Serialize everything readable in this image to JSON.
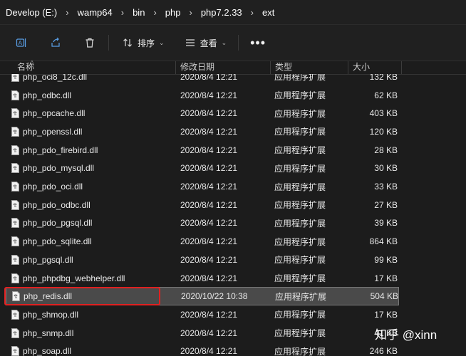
{
  "breadcrumb": [
    "Develop (E:)",
    "wamp64",
    "bin",
    "php",
    "php7.2.33",
    "ext"
  ],
  "toolbar": {
    "sort_label": "排序",
    "view_label": "查看",
    "more_label": "•••"
  },
  "columns": {
    "name": "名称",
    "date": "修改日期",
    "type": "类型",
    "size": "大小"
  },
  "rows": [
    {
      "name": "php_oci8_12c.dll",
      "date": "2020/8/4 12:21",
      "type": "应用程序扩展",
      "size": "132 KB"
    },
    {
      "name": "php_odbc.dll",
      "date": "2020/8/4 12:21",
      "type": "应用程序扩展",
      "size": "62 KB"
    },
    {
      "name": "php_opcache.dll",
      "date": "2020/8/4 12:21",
      "type": "应用程序扩展",
      "size": "403 KB"
    },
    {
      "name": "php_openssl.dll",
      "date": "2020/8/4 12:21",
      "type": "应用程序扩展",
      "size": "120 KB"
    },
    {
      "name": "php_pdo_firebird.dll",
      "date": "2020/8/4 12:21",
      "type": "应用程序扩展",
      "size": "28 KB"
    },
    {
      "name": "php_pdo_mysql.dll",
      "date": "2020/8/4 12:21",
      "type": "应用程序扩展",
      "size": "30 KB"
    },
    {
      "name": "php_pdo_oci.dll",
      "date": "2020/8/4 12:21",
      "type": "应用程序扩展",
      "size": "33 KB"
    },
    {
      "name": "php_pdo_odbc.dll",
      "date": "2020/8/4 12:21",
      "type": "应用程序扩展",
      "size": "27 KB"
    },
    {
      "name": "php_pdo_pgsql.dll",
      "date": "2020/8/4 12:21",
      "type": "应用程序扩展",
      "size": "39 KB"
    },
    {
      "name": "php_pdo_sqlite.dll",
      "date": "2020/8/4 12:21",
      "type": "应用程序扩展",
      "size": "864 KB"
    },
    {
      "name": "php_pgsql.dll",
      "date": "2020/8/4 12:21",
      "type": "应用程序扩展",
      "size": "99 KB"
    },
    {
      "name": "php_phpdbg_webhelper.dll",
      "date": "2020/8/4 12:21",
      "type": "应用程序扩展",
      "size": "17 KB"
    },
    {
      "name": "php_redis.dll",
      "date": "2020/10/22 10:38",
      "type": "应用程序扩展",
      "size": "504 KB",
      "selected": true
    },
    {
      "name": "php_shmop.dll",
      "date": "2020/8/4 12:21",
      "type": "应用程序扩展",
      "size": "17 KB"
    },
    {
      "name": "php_snmp.dll",
      "date": "2020/8/4 12:21",
      "type": "应用程序扩展",
      "size": "41 KB"
    },
    {
      "name": "php_soap.dll",
      "date": "2020/8/4 12:21",
      "type": "应用程序扩展",
      "size": "246 KB"
    }
  ],
  "watermark": "知乎 @xinn",
  "colors": {
    "selected_row": "#4a4a4a",
    "highlight_box": "#e02020",
    "background": "#1c1c1c"
  },
  "icons": [
    "ai-rename-icon",
    "share-icon",
    "delete-icon",
    "sort-icon",
    "view-icon",
    "chevron-right-icon",
    "chevron-down-icon",
    "dll-file-icon"
  ]
}
